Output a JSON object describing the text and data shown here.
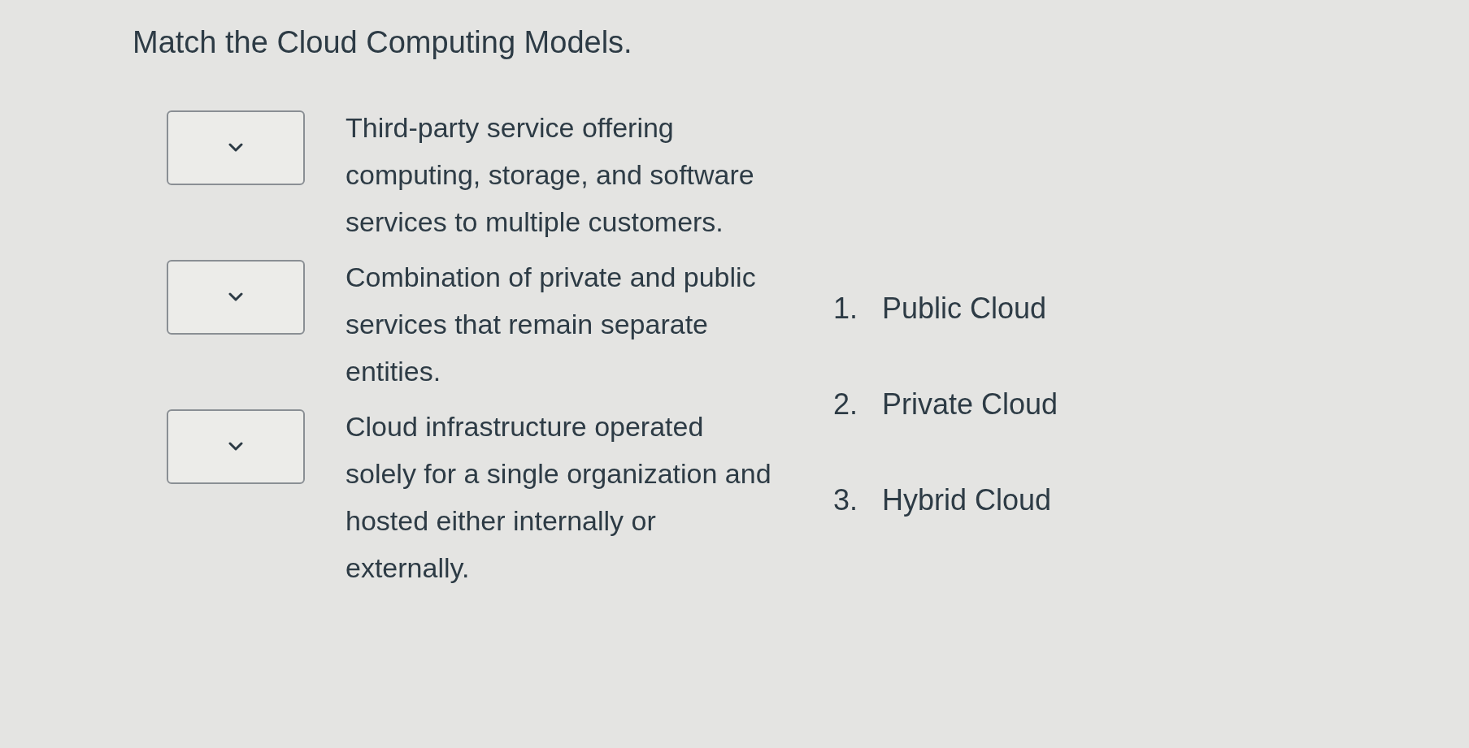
{
  "question": {
    "title": "Match the Cloud Computing Models."
  },
  "matches": [
    {
      "description": "Third-party service offering computing, storage, and software services to multiple customers."
    },
    {
      "description": "Combination of private and public services that remain separate entities."
    },
    {
      "description": "Cloud infrastructure operated solely for a single organization and hosted either internally or externally."
    }
  ],
  "options": [
    {
      "number": "1.",
      "label": "Public Cloud"
    },
    {
      "number": "2.",
      "label": "Private Cloud"
    },
    {
      "number": "3.",
      "label": "Hybrid Cloud"
    }
  ]
}
